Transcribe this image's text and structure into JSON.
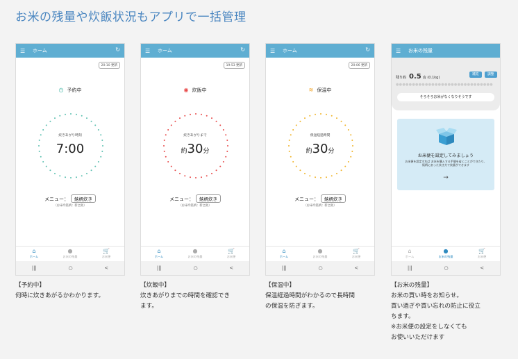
{
  "page_title": "お米の残量や炊飯状況もアプリで一括管理",
  "phones": [
    {
      "appbar_title": "ホーム",
      "time_chip": "20:10 更新",
      "status_label": "予約中",
      "status_icon": "clock-icon",
      "center_label": "炊きあがり時刻",
      "big_prefix": "",
      "big_value": "7:00",
      "big_suffix": "",
      "menu_label": "メニュー：",
      "menu_value": "銘柄炊き",
      "menu_sub": "（お米の銘柄：新之助）",
      "ring_color": "#5cc0b0",
      "nav": [
        "ホーム",
        "お米の残量",
        "お米便"
      ],
      "nav_active": 0
    },
    {
      "appbar_title": "ホーム",
      "time_chip": "19:53 更新",
      "status_label": "炊飯中",
      "status_icon": "rice-cooker-icon",
      "center_label": "炊きあがりまで",
      "big_prefix": "約",
      "big_value": "30",
      "big_suffix": "分",
      "menu_label": "メニュー：",
      "menu_value": "銘柄炊き",
      "menu_sub": "（お米の銘柄：新之助）",
      "ring_color": "#e84a4a",
      "nav": [
        "ホーム",
        "お米の残量",
        "お米便"
      ],
      "nav_active": 0
    },
    {
      "appbar_title": "ホーム",
      "time_chip": "20:06 更新",
      "status_label": "保温中",
      "status_icon": "heat-icon",
      "center_label": "保温経過時間",
      "big_prefix": "約",
      "big_value": "30",
      "big_suffix": "分",
      "menu_label": "メニュー：",
      "menu_value": "銘柄炊き",
      "menu_sub": "（お米の銘柄：新之助）",
      "ring_color": "#f0b429",
      "nav": [
        "ホーム",
        "お米の残量",
        "お米便"
      ],
      "nav_active": 0
    }
  ],
  "phone4": {
    "appbar_title": "お米の残量",
    "remain_label": "残り約",
    "remain_value": "0.5",
    "remain_unit": "合",
    "remain_sub": "(0.1kg)",
    "btn_refill": "補充",
    "btn_adjust": "調整",
    "warning": "そろそろお米がなくなりそうです",
    "card_title": "お米便を設定してみましょう",
    "card_text": "お米便を設定すれば お米を購入する手間を省くことができたり、 銘柄にあった炊き方で炊飯ができます",
    "card_arrow": "→",
    "nav": [
      "ホーム",
      "お米の残量",
      "お米便"
    ],
    "nav_active": 1
  },
  "sysnav": [
    "|||",
    "○",
    "<"
  ],
  "captions": [
    [
      "【予約中】",
      "何時に炊きあがるかわかります。"
    ],
    [
      "【炊飯中】",
      "炊きあがりまでの時間を確認でき",
      "ます。"
    ],
    [
      "【保温中】",
      "保温経過時間がわかるので長時間",
      "の保温を防ぎます。"
    ],
    [
      "【お米の残量】",
      "お米の買い時をお知らせ。",
      "買い過ぎや買い忘れの防止に役立",
      "ちます。",
      "※お米便の設定をしなくても",
      "お使いいただけます"
    ]
  ]
}
